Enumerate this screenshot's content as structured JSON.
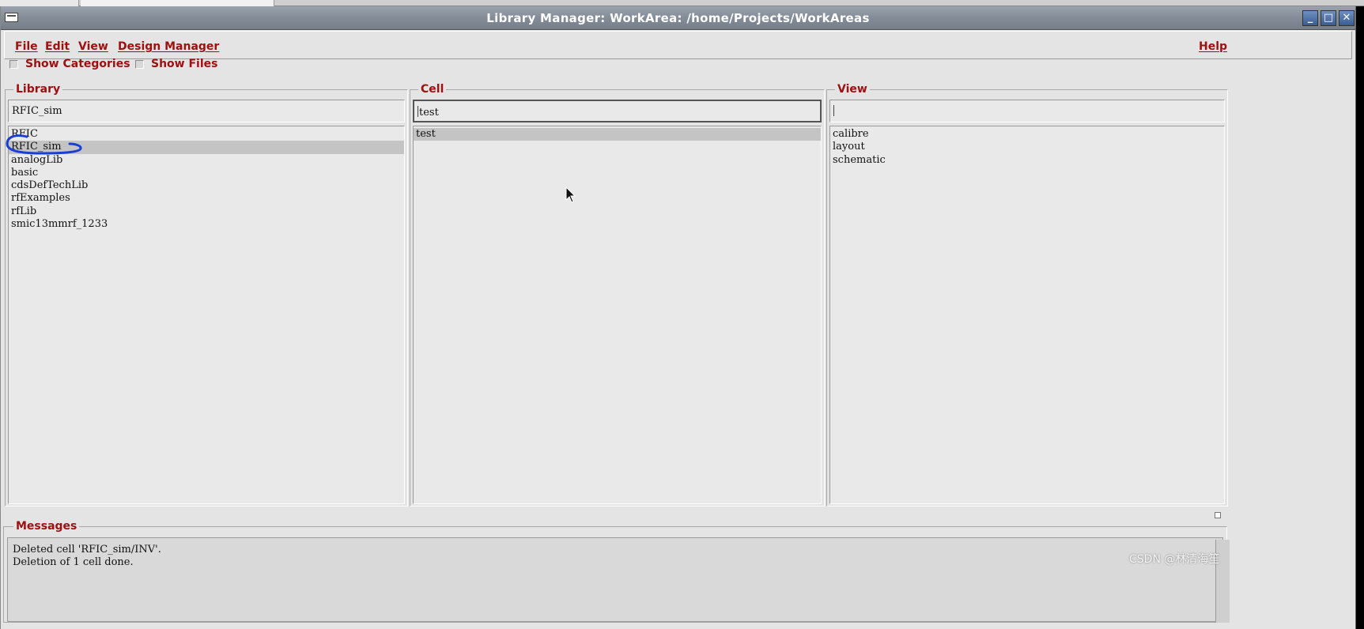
{
  "window": {
    "title": "Library Manager: WorkArea: /home/Projects/WorkAreas",
    "controls": {
      "minimize": "_",
      "maximize": "□",
      "close": "✕"
    }
  },
  "menubar": {
    "file": "File",
    "edit": "Edit",
    "view": "View",
    "design_manager": "Design Manager",
    "help": "Help"
  },
  "options": {
    "show_categories": {
      "label": "Show Categories",
      "checked": false
    },
    "show_files": {
      "label": "Show Files",
      "checked": false
    }
  },
  "library": {
    "label": "Library",
    "field_value": "RFIC_sim",
    "items": [
      "RFIC",
      "RFIC_sim",
      "analogLib",
      "basic",
      "cdsDefTechLib",
      "rfExamples",
      "rfLib",
      "smic13mmrf_1233"
    ],
    "selected": "RFIC_sim"
  },
  "cell": {
    "label": "Cell",
    "field_value": "test",
    "items": [
      "test"
    ],
    "selected": "test"
  },
  "view": {
    "label": "View",
    "field_value": "",
    "items": [
      "calibre",
      "layout",
      "schematic"
    ]
  },
  "messages": {
    "label": "Messages",
    "lines": [
      "Deleted cell 'RFIC_sim/INV'.",
      "Deletion of 1 cell done."
    ]
  },
  "watermark": "CSDN @林清海笙",
  "colors": {
    "label_red": "#a01010",
    "annotation_blue": "#1a3fd6",
    "title_bar": "#838c97",
    "window_bg": "#e4e4e4"
  }
}
